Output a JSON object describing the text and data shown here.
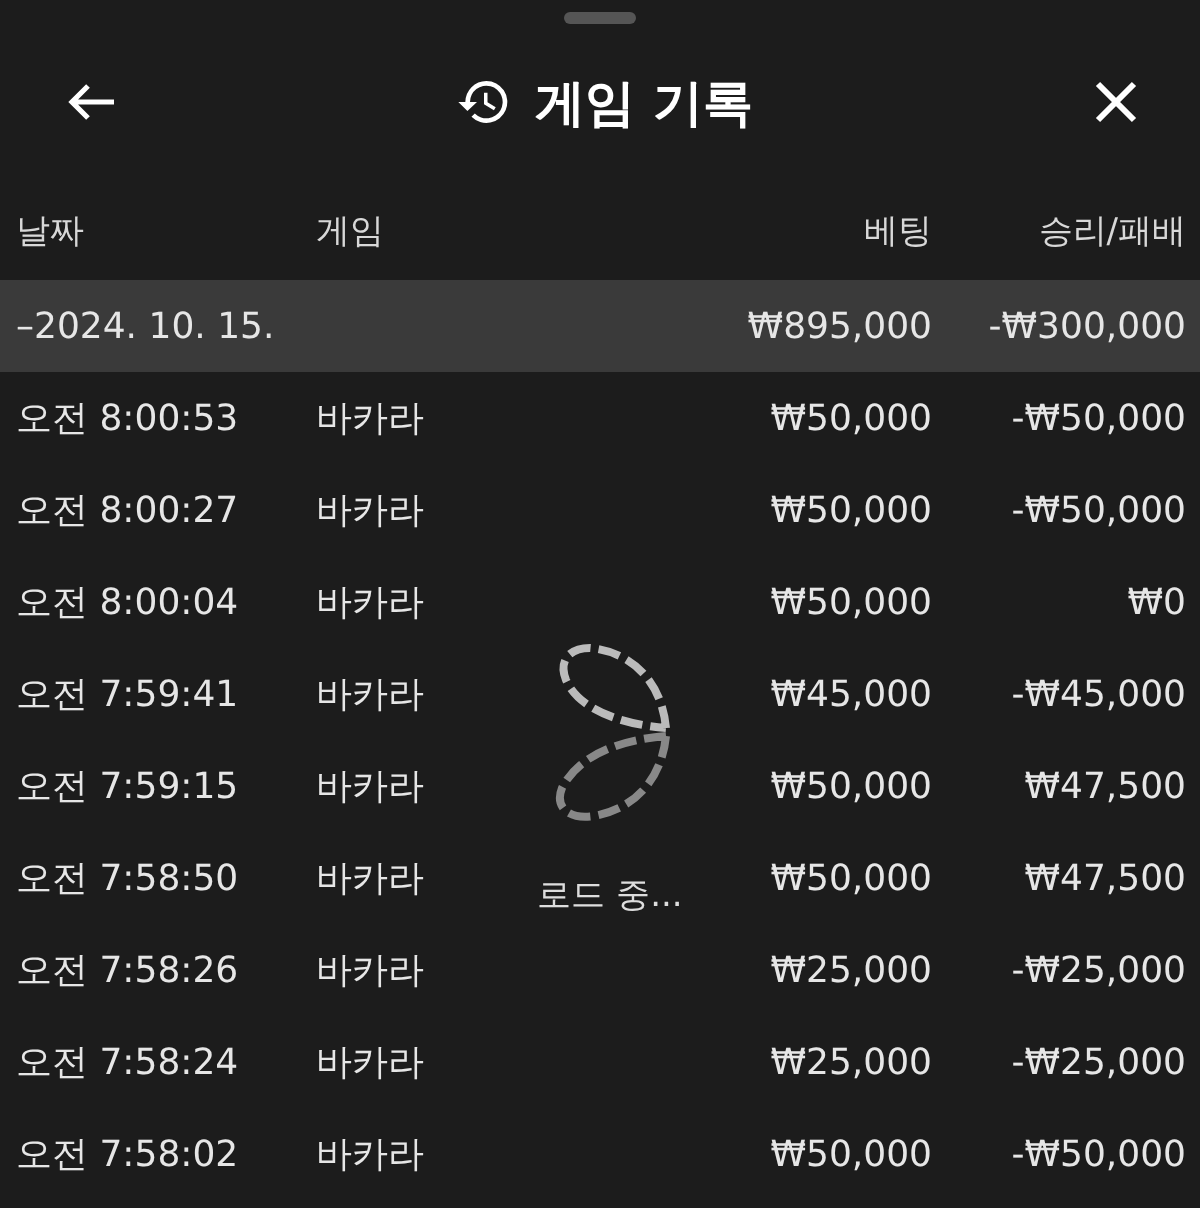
{
  "header": {
    "title": "게임 기록"
  },
  "table": {
    "columns": [
      "날짜",
      "게임",
      "베팅",
      "승리/패배"
    ],
    "summary": {
      "date": "–2024. 10. 15.",
      "bet": "₩895,000",
      "result": "-₩300,000"
    },
    "rows": [
      {
        "time": "오전 8:00:53",
        "game": "바카라",
        "bet": "₩50,000",
        "result": "-₩50,000"
      },
      {
        "time": "오전 8:00:27",
        "game": "바카라",
        "bet": "₩50,000",
        "result": "-₩50,000"
      },
      {
        "time": "오전 8:00:04",
        "game": "바카라",
        "bet": "₩50,000",
        "result": "₩0"
      },
      {
        "time": "오전 7:59:41",
        "game": "바카라",
        "bet": "₩45,000",
        "result": "-₩45,000"
      },
      {
        "time": "오전 7:59:15",
        "game": "바카라",
        "bet": "₩50,000",
        "result": "₩47,500"
      },
      {
        "time": "오전 7:58:50",
        "game": "바카라",
        "bet": "₩50,000",
        "result": "₩47,500"
      },
      {
        "time": "오전 7:58:26",
        "game": "바카라",
        "bet": "₩25,000",
        "result": "-₩25,000"
      },
      {
        "time": "오전 7:58:24",
        "game": "바카라",
        "bet": "₩25,000",
        "result": "-₩25,000"
      },
      {
        "time": "오전 7:58:02",
        "game": "바카라",
        "bet": "₩50,000",
        "result": "-₩50,000"
      }
    ]
  },
  "loading": {
    "text": "로드 중..."
  }
}
